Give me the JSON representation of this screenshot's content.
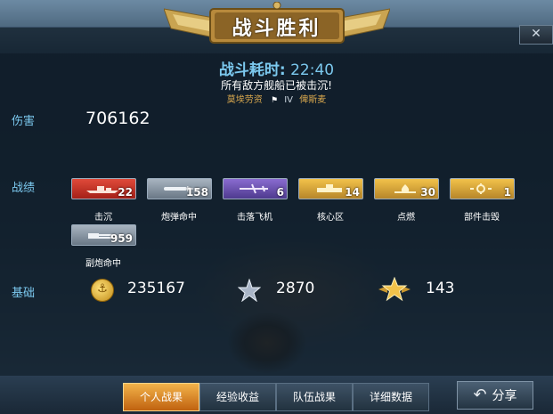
{
  "title": "战斗胜利",
  "close_icon_glyph": "✕",
  "battle": {
    "time_label": "战斗耗时:",
    "time_value": "22:40",
    "result_text": "所有敌方舰船已被击沉!",
    "player_name": "莫埃劳资",
    "ship_tier": "IV",
    "ship_name": "俾斯麦"
  },
  "damage": {
    "label": "伤害",
    "value": "706162"
  },
  "achievements": {
    "label": "战绩",
    "items": [
      {
        "caption": "击沉",
        "count": "22",
        "color": "red",
        "icon": "ship-icon"
      },
      {
        "caption": "炮弹命中",
        "count": "158",
        "color": "steel",
        "icon": "shell-icon"
      },
      {
        "caption": "击落飞机",
        "count": "6",
        "color": "purple",
        "icon": "plane-icon"
      },
      {
        "caption": "核心区",
        "count": "14",
        "color": "gold",
        "icon": "citadel-icon"
      },
      {
        "caption": "点燃",
        "count": "30",
        "color": "gold",
        "icon": "fire-icon"
      },
      {
        "caption": "部件击毁",
        "count": "1",
        "color": "gold",
        "icon": "gear-icon"
      },
      {
        "caption": "副炮命中",
        "count": "959",
        "color": "steel",
        "icon": "secondary-gun-icon"
      }
    ]
  },
  "base": {
    "label": "基础",
    "coins": "235167",
    "coin_icon_glyph": "⚓",
    "experience": "2870",
    "star_points": "143"
  },
  "tabs": [
    "个人战果",
    "经验收益",
    "队伍战果",
    "详细数据"
  ],
  "share_label": "分享",
  "share_icon_glyph": "↶"
}
